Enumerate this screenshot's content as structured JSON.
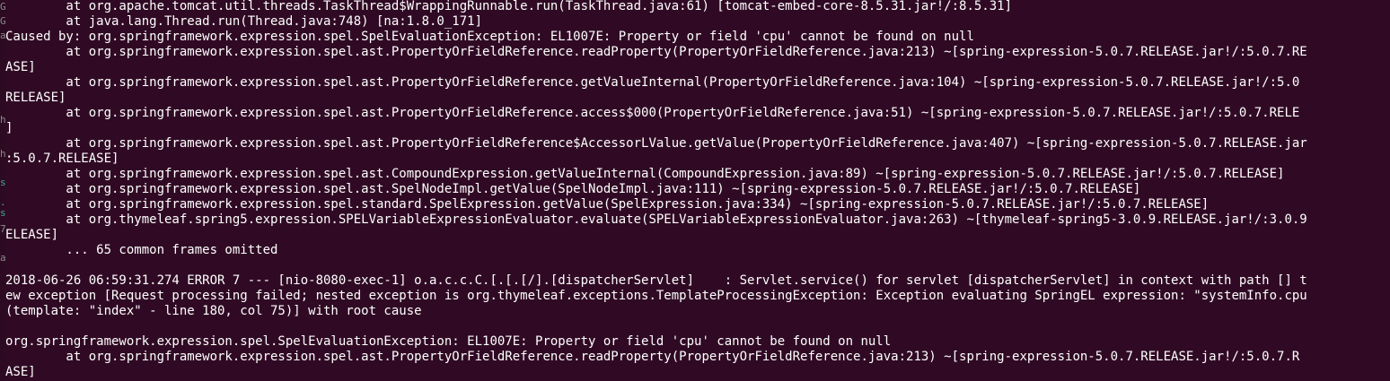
{
  "terminal": {
    "background_color": "#300a24",
    "text_color": "#ffffff",
    "lines": [
      "        at org.apache.tomcat.util.threads.TaskThread$WrappingRunnable.run(TaskThread.java:61) [tomcat-embed-core-8.5.31.jar!/:8.5.31]",
      "        at java.lang.Thread.run(Thread.java:748) [na:1.8.0_171]",
      "Caused by: org.springframework.expression.spel.SpelEvaluationException: EL1007E: Property or field 'cpu' cannot be found on null",
      "        at org.springframework.expression.spel.ast.PropertyOrFieldReference.readProperty(PropertyOrFieldReference.java:213) ~[spring-expression-5.0.7.RELEASE.jar!/:5.0.7.RE",
      "ASE]",
      "        at org.springframework.expression.spel.ast.PropertyOrFieldReference.getValueInternal(PropertyOrFieldReference.java:104) ~[spring-expression-5.0.7.RELEASE.jar!/:5.0",
      "RELEASE]",
      "        at org.springframework.expression.spel.ast.PropertyOrFieldReference.access$000(PropertyOrFieldReference.java:51) ~[spring-expression-5.0.7.RELEASE.jar!/:5.0.7.RELE",
      "]",
      "        at org.springframework.expression.spel.ast.PropertyOrFieldReference$AccessorLValue.getValue(PropertyOrFieldReference.java:407) ~[spring-expression-5.0.7.RELEASE.jar",
      ":5.0.7.RELEASE]",
      "        at org.springframework.expression.spel.ast.CompoundExpression.getValueInternal(CompoundExpression.java:89) ~[spring-expression-5.0.7.RELEASE.jar!/:5.0.7.RELEASE]",
      "        at org.springframework.expression.spel.ast.SpelNodeImpl.getValue(SpelNodeImpl.java:111) ~[spring-expression-5.0.7.RELEASE.jar!/:5.0.7.RELEASE]",
      "        at org.springframework.expression.spel.standard.SpelExpression.getValue(SpelExpression.java:334) ~[spring-expression-5.0.7.RELEASE.jar!/:5.0.7.RELEASE]",
      "        at org.thymeleaf.spring5.expression.SPELVariableExpressionEvaluator.evaluate(SPELVariableExpressionEvaluator.java:263) ~[thymeleaf-spring5-3.0.9.RELEASE.jar!/:3.0.9",
      "ELEASE]",
      "        ... 65 common frames omitted",
      "",
      "2018-06-26 06:59:31.274 ERROR 7 --- [nio-8080-exec-1] o.a.c.c.C.[.[.[/].[dispatcherServlet]    : Servlet.service() for servlet [dispatcherServlet] in context with path [] t",
      "ew exception [Request processing failed; nested exception is org.thymeleaf.exceptions.TemplateProcessingException: Exception evaluating SpringEL expression: \"systemInfo.cpu",
      "(template: \"index\" - line 180, col 75)] with root cause",
      "",
      "org.springframework.expression.spel.SpelEvaluationException: EL1007E: Property or field 'cpu' cannot be found on null",
      "        at org.springframework.expression.spel.ast.PropertyOrFieldReference.readProperty(PropertyOrFieldReference.java:213) ~[spring-expression-5.0.7.RELEASE.jar!/:5.0.7.R",
      "ASE]"
    ]
  },
  "gutter": {
    "marks": [
      "G",
      "G",
      "a",
      "",
      "",
      "",
      "",
      "h",
      "",
      "h",
      "",
      "s",
      ".",
      "s",
      "7",
      "",
      "a"
    ]
  }
}
